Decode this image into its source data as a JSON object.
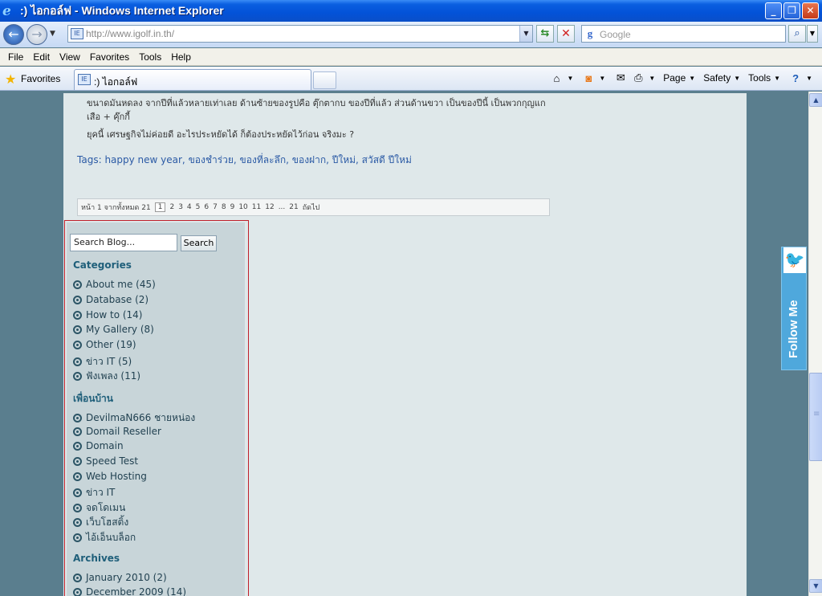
{
  "window": {
    "title": ":) ไอกอล์ฟ - Windows Internet Explorer"
  },
  "address": {
    "url": "http://www.igolf.in.th/"
  },
  "search": {
    "placeholder": "Google"
  },
  "menu": {
    "items": [
      "File",
      "Edit",
      "View",
      "Favorites",
      "Tools",
      "Help"
    ]
  },
  "favbar": {
    "favorites_label": "Favorites",
    "tab_title": ":) ไอกอล์ฟ"
  },
  "cmdbar": {
    "page": "Page",
    "safety": "Safety",
    "tools": "Tools"
  },
  "post": {
    "line1": "ขนาดมันหดลง จากปีที่แล้วหลายเท่าเลย  ด้านซ้ายของรูปคือ ตุ๊กตากบ ของปีที่แล้ว  ส่วนด้านขวา เป็นของปีนี้ เป็นพวกกุญแก",
    "line2": "เสือ + คุ๊กกี้",
    "line3": "ยุคนี้ เศรษฐกิจไม่ค่อยดี อะไรประหยัดได้ ก็ต้องประหยัดไว้ก่อน  จริงมะ ?",
    "tags_label": "Tags:",
    "tags": "happy new year, ของชำร่วย, ของที่ละลึก, ของฝาก, ปีใหม่, สวัสดี ปีใหม่"
  },
  "pager": {
    "summary": "หน้า 1 จากทั้งหมด 21",
    "current": "1",
    "pages": [
      "2",
      "3",
      "4",
      "5",
      "6",
      "7",
      "8",
      "9",
      "10",
      "11",
      "12",
      "...",
      "21"
    ],
    "next": "ถัดไป"
  },
  "sidebar": {
    "search_value": "Search Blog...",
    "search_button": "Search",
    "categories_title": "Categories",
    "categories": [
      "About me (45)",
      "Database (2)",
      "How to (14)",
      "My Gallery (8)",
      "Other (19)",
      "ข่าว IT (5)",
      "ฟังเพลง (11)"
    ],
    "friends_title": "เพื่อนบ้าน",
    "friends": [
      "DevilmaN666 ชายหน่อง",
      "Domail Reseller",
      "Domain",
      "Speed Test",
      "Web Hosting",
      "ข่าว IT",
      "จดโดเมน",
      "เว็บโฮสติ้ง",
      "ไอ้เอ็นบล็อก"
    ],
    "archives_title": "Archives",
    "archives": [
      "January 2010 (2)",
      "December 2009 (14)"
    ]
  },
  "follow": {
    "label": "Follow Me"
  }
}
